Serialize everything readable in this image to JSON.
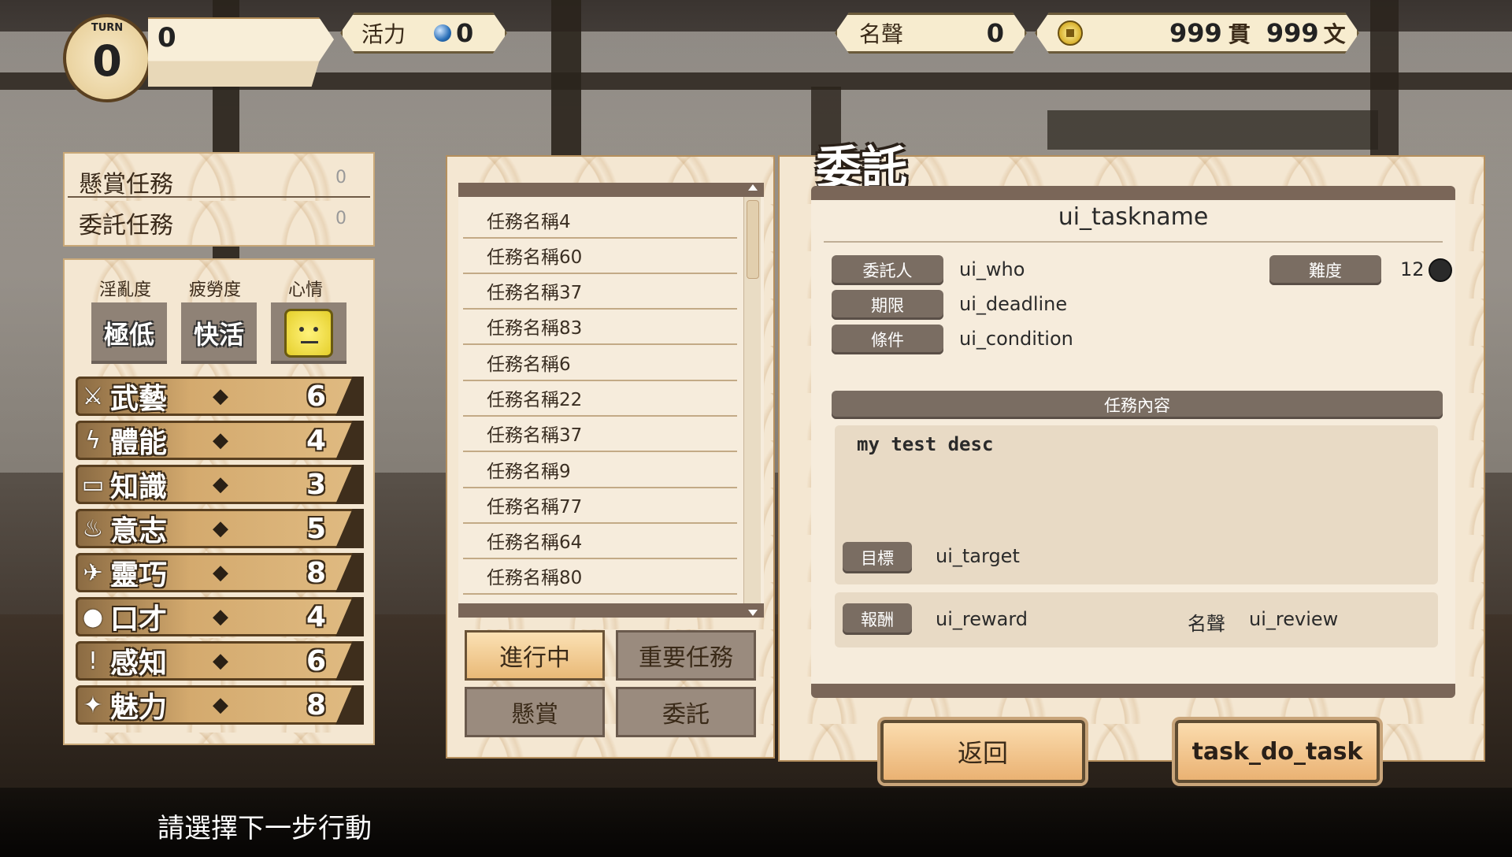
{
  "hud": {
    "turn_label": "TURN",
    "turn_value": "0",
    "top_value": "0",
    "vitality_label": "活力",
    "vitality_value": "0",
    "fame_label": "名聲",
    "fame_value": "0",
    "money_guan": "999",
    "money_guan_unit": "貫",
    "money_wen": "999",
    "money_wen_unit": "文"
  },
  "quest_counts": [
    {
      "label": "懸賞任務",
      "value": "0"
    },
    {
      "label": "委託任務",
      "value": "0"
    }
  ],
  "status": {
    "headers": [
      "淫亂度",
      "疲勞度",
      "心情"
    ],
    "lewdness": "極低",
    "fatigue": "快活",
    "mood_icon": "neutral-face-icon"
  },
  "stats": [
    {
      "name": "武藝",
      "value": "6",
      "icon": "sword-icon"
    },
    {
      "name": "體能",
      "value": "4",
      "icon": "lightning-icon"
    },
    {
      "name": "知識",
      "value": "3",
      "icon": "book-icon"
    },
    {
      "name": "意志",
      "value": "5",
      "icon": "flame-icon"
    },
    {
      "name": "靈巧",
      "value": "8",
      "icon": "runner-icon"
    },
    {
      "name": "口才",
      "value": "4",
      "icon": "speech-bubble-icon"
    },
    {
      "name": "感知",
      "value": "6",
      "icon": "exclamation-icon"
    },
    {
      "name": "魅力",
      "value": "8",
      "icon": "sparkle-icon"
    }
  ],
  "task_list": [
    "任務名稱4",
    "任務名稱60",
    "任務名稱37",
    "任務名稱83",
    "任務名稱6",
    "任務名稱22",
    "任務名稱37",
    "任務名稱9",
    "任務名稱77",
    "任務名稱64",
    "任務名稱80"
  ],
  "list_tabs": {
    "in_progress": "進行中",
    "important": "重要任務",
    "bounty": "懸賞",
    "commission": "委託"
  },
  "detail": {
    "panel_title": "委託",
    "task_name": "ui_taskname",
    "client_label": "委託人",
    "client_value": "ui_who",
    "difficulty_label": "難度",
    "difficulty_value": "12",
    "deadline_label": "期限",
    "deadline_value": "ui_deadline",
    "condition_label": "條件",
    "condition_value": "ui_condition",
    "content_header": "任務內容",
    "description": "my test desc",
    "target_label": "目標",
    "target_value": "ui_target",
    "reward_label": "報酬",
    "reward_value": "ui_reward",
    "fame_label": "名聲",
    "fame_value": "ui_review"
  },
  "buttons": {
    "back": "返回",
    "do_task": "task_do_task"
  },
  "bottom_prompt": "請選擇下一步行動",
  "colors": {
    "panel_bg": "#f6ecdc",
    "label_bg": "#7a6d62",
    "accent_gold": "#e6b87a",
    "dark_border": "#5a4020"
  }
}
